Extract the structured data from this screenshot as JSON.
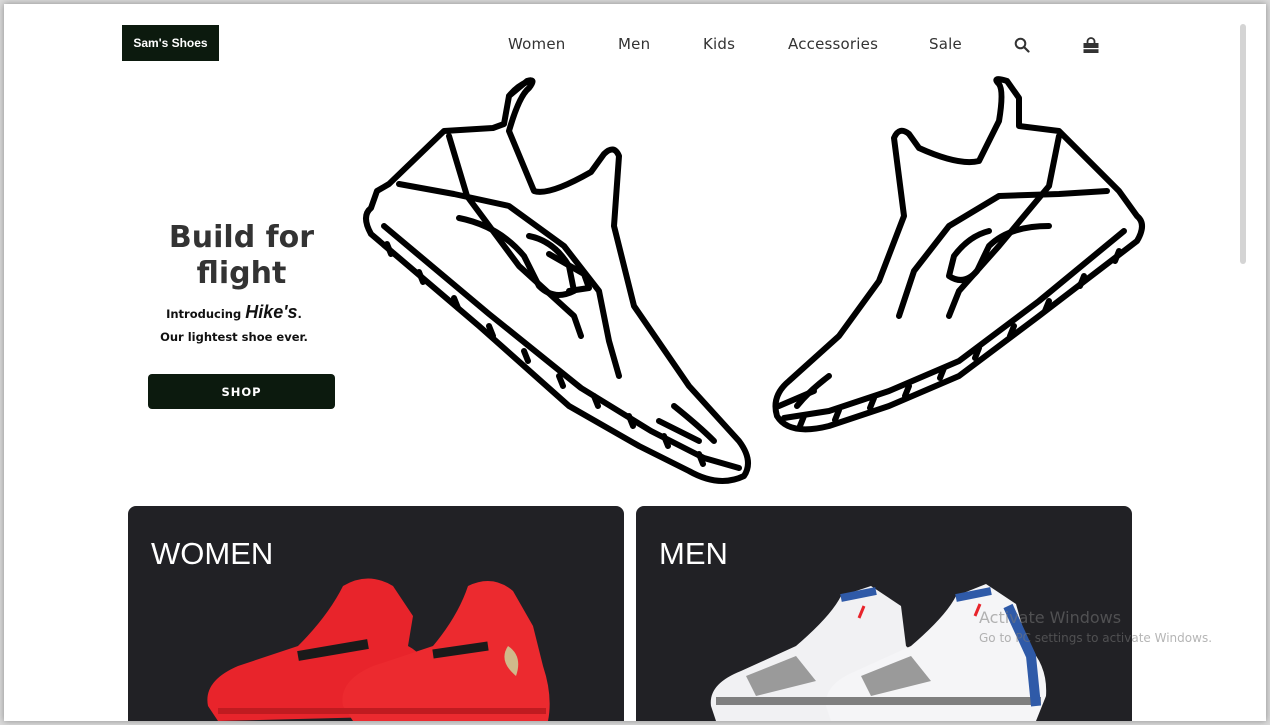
{
  "header": {
    "logo": "Sam's Shoes",
    "nav": [
      "Women",
      "Men",
      "Kids",
      "Accessories",
      "Sale"
    ],
    "search_icon": "search-icon",
    "cart_icon": "shopping-bag-icon"
  },
  "hero": {
    "title_line1": "Build for",
    "title_line2": "flight",
    "intro_prefix": "Introducing",
    "brand": "Hike's",
    "intro_suffix": ".",
    "subtitle": "Our lightest shoe ever.",
    "cta": "SHOP"
  },
  "categories": [
    {
      "title": "WOMEN",
      "accent": "#e8242b"
    },
    {
      "title": "MEN",
      "accent": "#2f5aa8"
    }
  ],
  "watermark": {
    "line1": "Activate Windows",
    "line2": "Go to PC settings to activate Windows."
  },
  "colors": {
    "brand_dark": "#0c1a0e",
    "card_bg": "#212125"
  }
}
